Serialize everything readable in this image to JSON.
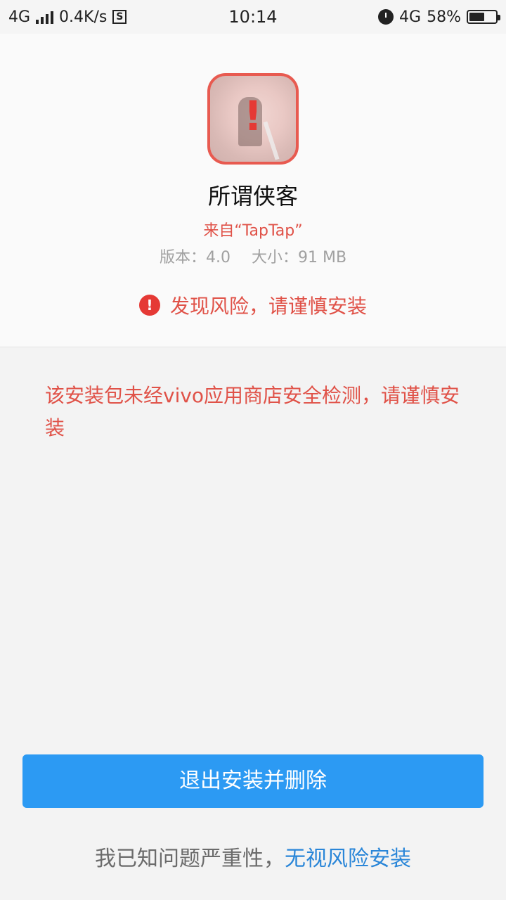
{
  "status_bar": {
    "network": "4G",
    "speed": "0.4K/s",
    "s_icon": "S",
    "time": "10:14",
    "network_right": "4G",
    "battery": "58%"
  },
  "app": {
    "name": "所谓侠客",
    "source": "来自“TapTap”",
    "version": "版本：4.0",
    "size": "大小：91 MB",
    "warning": "发现风险，请谨慎安装",
    "icon_mark": "!"
  },
  "detail_text": "该安装包未经vivo应用商店安全检测，请谨慎安装",
  "actions": {
    "exit_delete": "退出安装并删除",
    "ack_text": "我已知问题严重性，",
    "ignore_install": "无视风险安装"
  },
  "colors": {
    "danger": "#e05248",
    "primary": "#2c9af3",
    "link": "#2a86d8"
  },
  "icons": [
    "signal-icon",
    "storage-s-icon",
    "alarm-clock-icon",
    "data-arrows-icon",
    "battery-icon",
    "warning-icon"
  ]
}
